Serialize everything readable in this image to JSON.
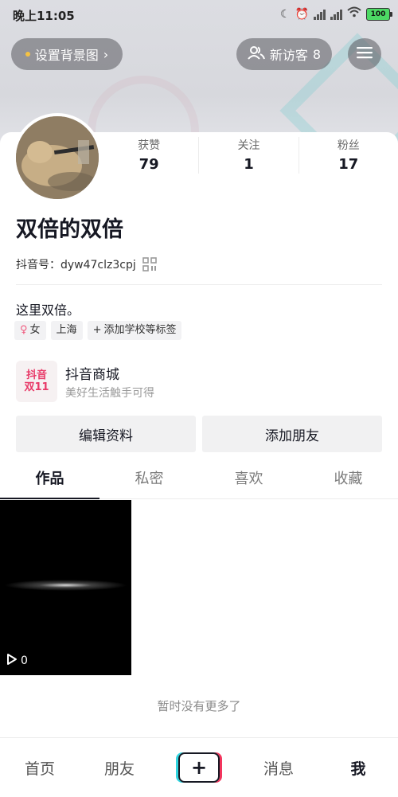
{
  "status_bar": {
    "time": "晚上11:05",
    "battery": "100",
    "icons": [
      "moon-icon",
      "alarm-icon",
      "signal-icon",
      "signal-icon",
      "wifi-icon",
      "battery-icon"
    ]
  },
  "header": {
    "set_background_label": "设置背景图",
    "new_visitors_label": "新访客",
    "new_visitors_count": "8"
  },
  "profile": {
    "stats": [
      {
        "label": "获赞",
        "value": "79"
      },
      {
        "label": "关注",
        "value": "1"
      },
      {
        "label": "粉丝",
        "value": "17"
      }
    ],
    "nickname": "双倍的双倍",
    "douyin_id": "抖音号：dyw47clz3cpj",
    "bio": "这里双倍。",
    "tags": {
      "gender": "女",
      "location": "上海",
      "add_school": "添加学校等标签"
    }
  },
  "mall": {
    "logo_line1": "抖音",
    "logo_line2": "双11",
    "title": "抖音商城",
    "subtitle": "美好生活触手可得"
  },
  "actions": {
    "edit_profile": "编辑资料",
    "add_friend": "添加朋友"
  },
  "tabs": [
    "作品",
    "私密",
    "喜欢",
    "收藏"
  ],
  "video": {
    "play_count": "0"
  },
  "no_more_text": "暂时没有更多了",
  "bottom_nav": {
    "home": "首页",
    "friends": "朋友",
    "messages": "消息",
    "me": "我"
  },
  "colors": {
    "accent_cyan": "#30d5e0",
    "accent_red": "#f3355d",
    "tag_female": "#f05a7e"
  }
}
